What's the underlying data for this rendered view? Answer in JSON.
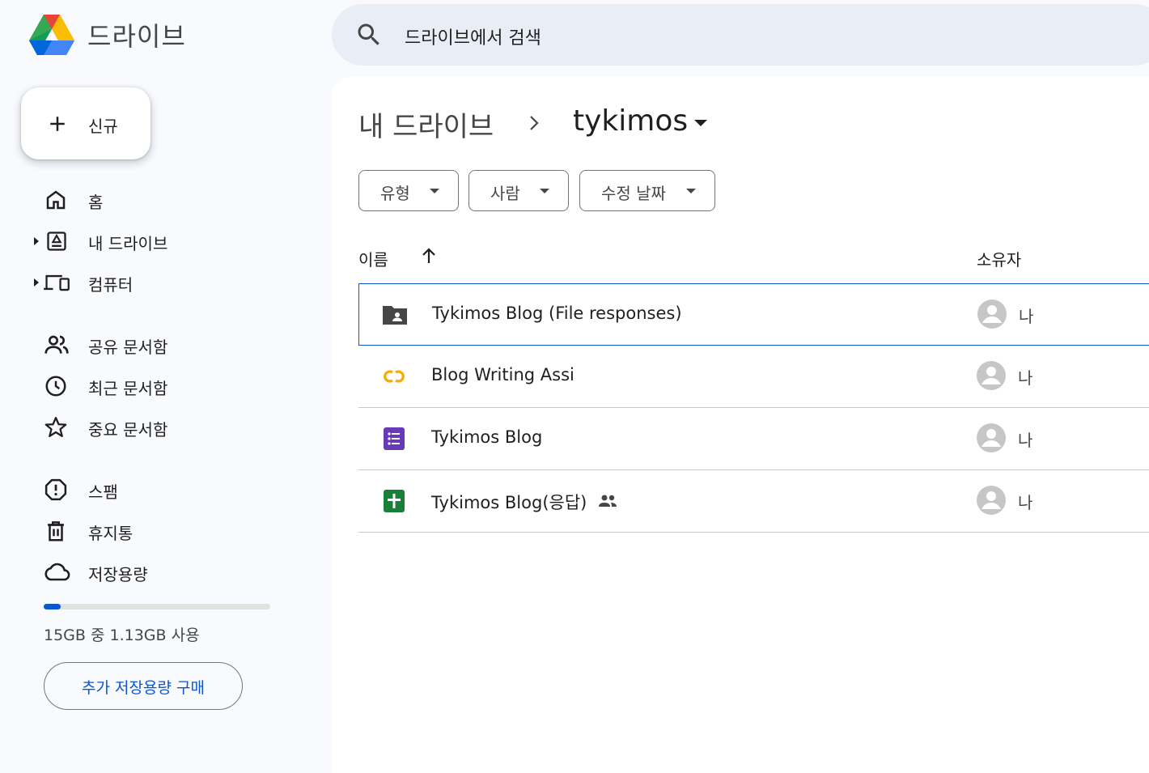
{
  "app": {
    "title": "드라이브"
  },
  "search": {
    "placeholder": "드라이브에서 검색"
  },
  "new_button": {
    "label": "신규"
  },
  "sidebar": {
    "items": [
      {
        "label": "홈",
        "icon": "home-icon"
      },
      {
        "label": "내 드라이브",
        "icon": "my-drive-icon",
        "expandable": true
      },
      {
        "label": "컴퓨터",
        "icon": "computers-icon",
        "expandable": true
      },
      {
        "label": "공유 문서함",
        "icon": "shared-with-me-icon"
      },
      {
        "label": "최근 문서함",
        "icon": "recent-icon"
      },
      {
        "label": "중요 문서함",
        "icon": "starred-icon"
      },
      {
        "label": "스팸",
        "icon": "spam-icon"
      },
      {
        "label": "휴지통",
        "icon": "trash-icon"
      },
      {
        "label": "저장용량",
        "icon": "cloud-icon"
      }
    ]
  },
  "storage": {
    "used_fraction": 0.075,
    "text": "15GB 중 1.13GB 사용",
    "buy_label": "추가 저장용량 구매"
  },
  "breadcrumb": {
    "root": "내 드라이브",
    "current": "tykimos"
  },
  "filters": [
    {
      "label": "유형"
    },
    {
      "label": "사람"
    },
    {
      "label": "수정 날짜"
    }
  ],
  "table": {
    "headers": {
      "name": "이름",
      "owner": "소유자"
    },
    "rows": [
      {
        "name": "Tykimos Blog (File responses)",
        "type": "shared-folder",
        "owner": "나",
        "selected": true,
        "shared": false
      },
      {
        "name": "Blog Writing Assi",
        "type": "colab",
        "owner": "나",
        "selected": false,
        "shared": false
      },
      {
        "name": "Tykimos Blog",
        "type": "google-forms",
        "owner": "나",
        "selected": false,
        "shared": false
      },
      {
        "name": "Tykimos Blog(응답)",
        "type": "google-sheets",
        "owner": "나",
        "selected": false,
        "shared": true
      }
    ]
  },
  "colors": {
    "accent": "#0b57d0",
    "background": "#f8fafd",
    "search_bg": "#e9eef6",
    "forms_purple": "#673ab7",
    "sheets_green": "#188038",
    "colab_orange": "#f9ab00"
  }
}
